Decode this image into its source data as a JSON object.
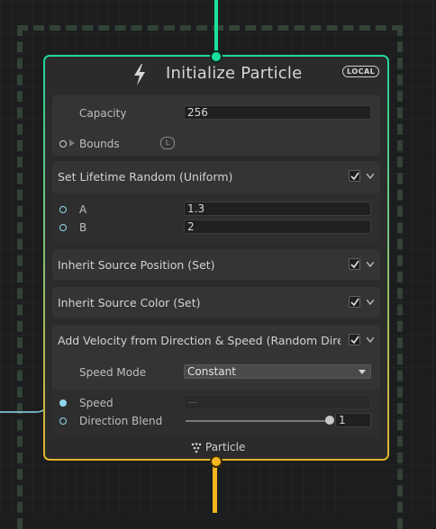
{
  "node": {
    "title": "Initialize Particle",
    "space_badge": "LOCAL",
    "footer_label": "Particle",
    "capacity": {
      "label": "Capacity",
      "value": "256"
    },
    "bounds": {
      "label": "Bounds",
      "space": "L"
    }
  },
  "blocks": [
    {
      "title": "Set Lifetime Random (Uniform)",
      "enabled": true,
      "fields": [
        {
          "label": "A",
          "value": "1.3"
        },
        {
          "label": "B",
          "value": "2"
        }
      ]
    },
    {
      "title": "Inherit Source Position (Set)",
      "enabled": true
    },
    {
      "title": "Inherit Source Color (Set)",
      "enabled": true
    },
    {
      "title": "Add Velocity from Direction & Speed (Random Direction)",
      "enabled": true,
      "speed_mode": {
        "label": "Speed Mode",
        "value": "Constant"
      },
      "speed": {
        "label": "Speed",
        "value": "—"
      },
      "direction_blend": {
        "label": "Direction Blend",
        "value": "1",
        "fraction": 1.0
      }
    }
  ],
  "colors": {
    "input_flow": "#19e19b",
    "output_flow": "#f4b51e",
    "port": "#8ed8ec"
  }
}
